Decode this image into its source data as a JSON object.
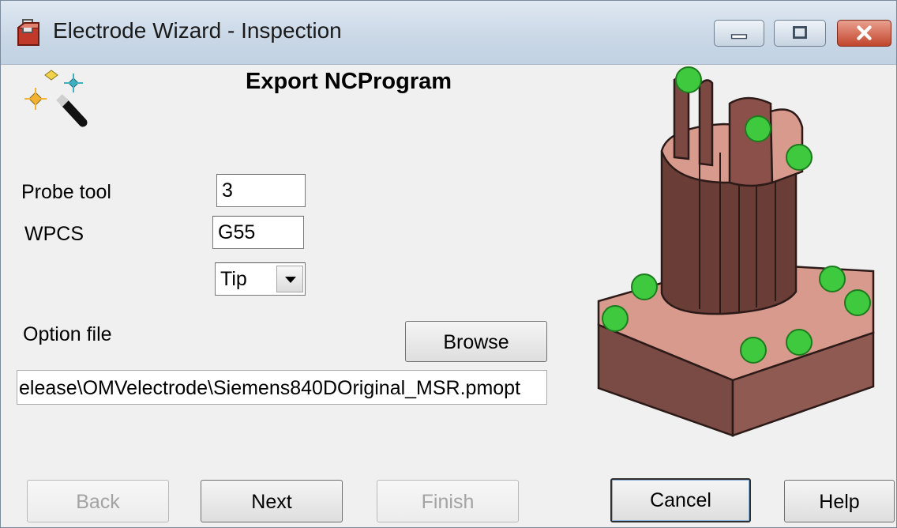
{
  "window": {
    "title": "Electrode Wizard - Inspection",
    "controls": [
      "minimize-icon",
      "maximize-icon",
      "close-icon"
    ]
  },
  "page": {
    "heading": "Export NCProgram"
  },
  "form": {
    "probe_tool_label": "Probe tool",
    "probe_tool_value": "3",
    "wpcs_label": "WPCS",
    "wpcs_value": "G55",
    "tip_select_value": "Tip",
    "option_file_label": "Option file",
    "browse_label": "Browse",
    "option_file_path": "elease\\OMVelectrode\\Siemens840DOriginal_MSR.pmopt"
  },
  "buttons": {
    "back": "Back",
    "next": "Next",
    "finish": "Finish",
    "cancel": "Cancel",
    "help": "Help"
  },
  "colors": {
    "electrode": "#8a5a52",
    "probe_point": "#3ec93e",
    "close_button": "#c9492f"
  },
  "icons": {
    "app": "electrode-app-icon",
    "wizard": "wizard-wand-icon",
    "dropdown": "chevron-down-icon"
  }
}
